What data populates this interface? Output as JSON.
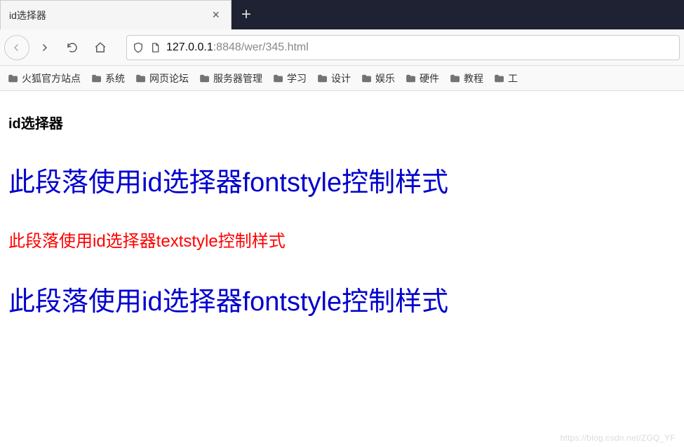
{
  "tab": {
    "title": "id选择器"
  },
  "address": {
    "host": "127.0.0.1",
    "port_path": ":8848/wer/345.html"
  },
  "bookmarks": [
    "火狐官方站点",
    "系统",
    "网页论坛",
    "服务器管理",
    "学习",
    "设计",
    "娱乐",
    "硬件",
    "教程",
    "工"
  ],
  "page": {
    "heading": "id选择器",
    "p1": "此段落使用id选择器fontstyle控制样式",
    "p2": "此段落使用id选择器textstyle控制样式",
    "p3": "此段落使用id选择器fontstyle控制样式"
  },
  "watermark": "https://blog.csdn.net/ZGQ_YF"
}
